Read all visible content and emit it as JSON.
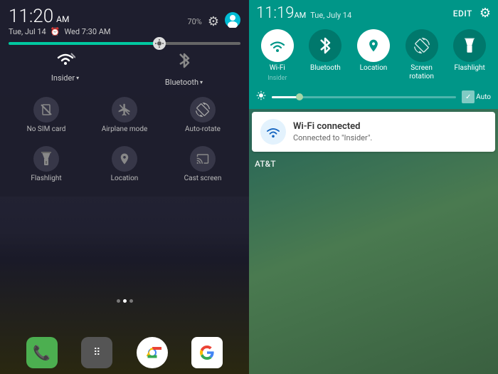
{
  "left": {
    "time": "11:20",
    "time_am": "AM",
    "date": "Tue, Jul 14",
    "alarm": "Wed 7:30 AM",
    "battery": "70%",
    "wifi_label": "Insider",
    "wifi_arrow": "▾",
    "bluetooth_label": "Bluetooth",
    "bluetooth_arrow": "▾",
    "toggle1_label": "No SIM card",
    "toggle2_label": "Airplane mode",
    "toggle3_label": "Auto-rotate",
    "toggle4_label": "Flashlight",
    "toggle5_label": "Location",
    "toggle6_label": "Cast screen"
  },
  "right": {
    "time": "11:19",
    "time_am": "AM",
    "date": "Tue, July 14",
    "edit_label": "EDIT",
    "tiles": [
      {
        "label": "Wi-Fi",
        "sublabel": "Insider",
        "active": true
      },
      {
        "label": "Bluetooth",
        "sublabel": "",
        "active": false
      },
      {
        "label": "Location",
        "sublabel": "",
        "active": true
      },
      {
        "label": "Screen\nrotation",
        "sublabel": "",
        "active": false
      },
      {
        "label": "Flashlight",
        "sublabel": "",
        "active": false
      }
    ],
    "auto_label": "Auto",
    "notif_title": "Wi-Fi connected",
    "notif_sub": "Connected to \"Insider\".",
    "carrier": "AT&T"
  }
}
